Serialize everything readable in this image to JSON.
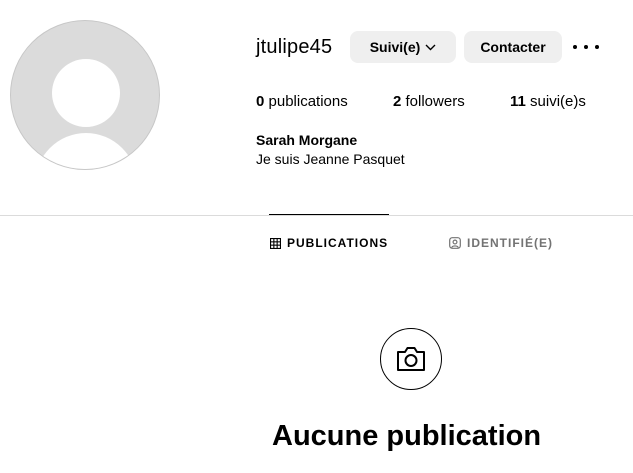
{
  "profile": {
    "username": "jtulipe45",
    "full_name": "Sarah Morgane",
    "bio": "Je suis Jeanne Pasquet"
  },
  "actions": {
    "follow_label": "Suivi(e)",
    "contact_label": "Contacter"
  },
  "stats": {
    "posts_count": "0",
    "posts_label": " publications",
    "followers_count": "2",
    "followers_label": " followers",
    "following_count": "11",
    "following_label": " suivi(e)s"
  },
  "tabs": [
    {
      "label": "PUBLICATIONS",
      "icon": "grid-icon",
      "active": true
    },
    {
      "label": "IDENTIFIÉ(E)",
      "icon": "tagged-icon",
      "active": false
    }
  ],
  "empty_state": {
    "icon": "camera-icon",
    "title": "Aucune publication"
  }
}
